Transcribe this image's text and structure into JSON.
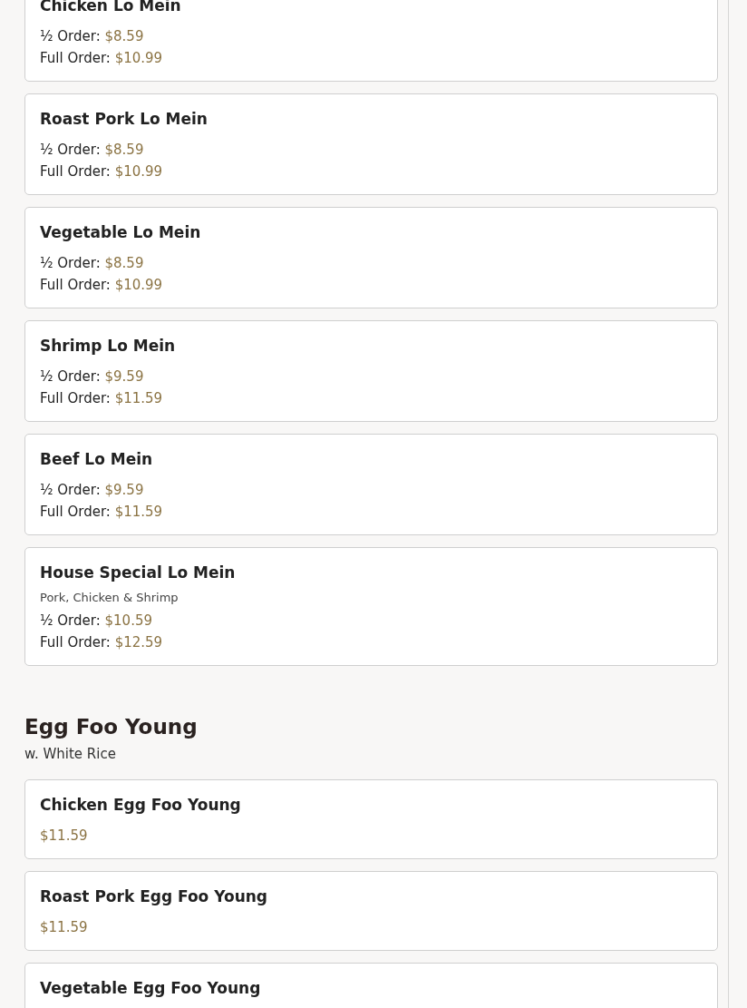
{
  "sections": [
    {
      "items": [
        {
          "name": "Chicken Lo Mein",
          "prices": [
            {
              "label": "½ Order:",
              "price": "$8.59"
            },
            {
              "label": "Full Order:",
              "price": "$10.99"
            }
          ]
        },
        {
          "name": "Roast Pork Lo Mein",
          "prices": [
            {
              "label": "½ Order:",
              "price": "$8.59"
            },
            {
              "label": "Full Order:",
              "price": "$10.99"
            }
          ]
        },
        {
          "name": "Vegetable Lo Mein",
          "prices": [
            {
              "label": "½ Order:",
              "price": "$8.59"
            },
            {
              "label": "Full Order:",
              "price": "$10.99"
            }
          ]
        },
        {
          "name": "Shrimp Lo Mein",
          "prices": [
            {
              "label": "½ Order:",
              "price": "$9.59"
            },
            {
              "label": "Full Order:",
              "price": "$11.59"
            }
          ]
        },
        {
          "name": "Beef Lo Mein",
          "prices": [
            {
              "label": "½ Order:",
              "price": "$9.59"
            },
            {
              "label": "Full Order:",
              "price": "$11.59"
            }
          ]
        },
        {
          "name": "House Special Lo Mein",
          "description": "Pork, Chicken & Shrimp",
          "prices": [
            {
              "label": "½ Order:",
              "price": "$10.59"
            },
            {
              "label": "Full Order:",
              "price": "$12.59"
            }
          ]
        }
      ]
    },
    {
      "heading": "Egg Foo Young",
      "note": "w. White Rice",
      "items": [
        {
          "name": "Chicken Egg Foo Young",
          "prices": [
            {
              "price": "$11.59"
            }
          ]
        },
        {
          "name": "Roast Pork Egg Foo Young",
          "prices": [
            {
              "price": "$11.59"
            }
          ]
        },
        {
          "name": "Vegetable Egg Foo Young"
        }
      ]
    }
  ]
}
